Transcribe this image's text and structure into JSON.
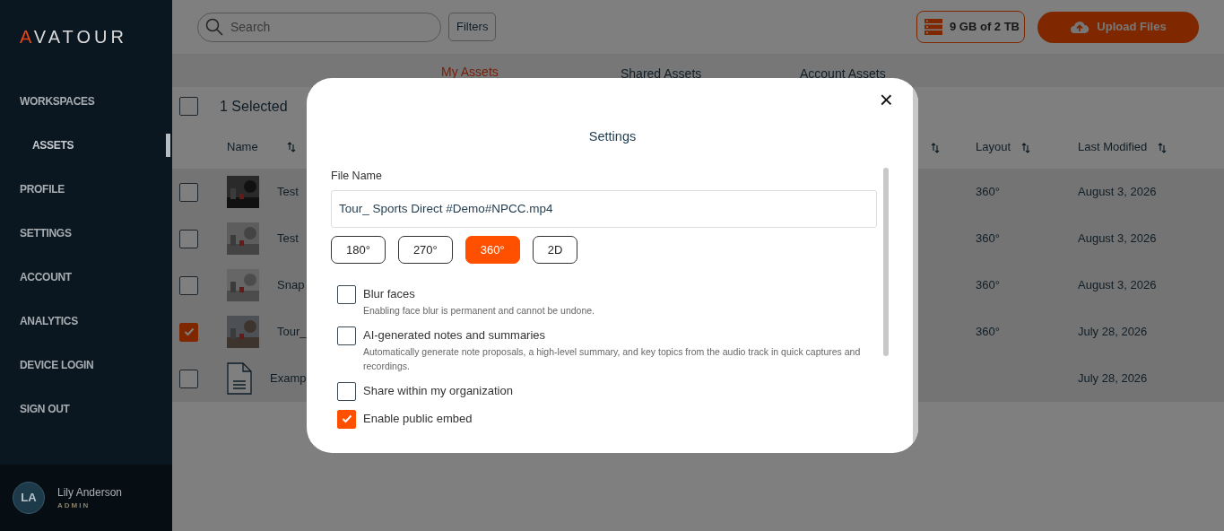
{
  "sidebar": {
    "logo": "AVATOUR",
    "items": [
      {
        "label": "WORKSPACES",
        "selected": false,
        "children": [
          {
            "label": "ASSETS",
            "selected": true
          }
        ]
      },
      {
        "label": "PROFILE",
        "selected": false
      },
      {
        "label": "SETTINGS",
        "selected": false
      },
      {
        "label": "ACCOUNT",
        "selected": false
      },
      {
        "label": "ANALYTICS",
        "selected": false
      },
      {
        "label": "DEVICE LOGIN",
        "selected": false
      },
      {
        "label": "SIGN OUT",
        "selected": false
      }
    ],
    "user": {
      "initials": "LA",
      "name": "Lily Anderson",
      "role": "ADMIN"
    }
  },
  "topbar": {
    "search": {
      "placeholder": "Search"
    },
    "filters": "Filters",
    "storage": "9 GB of 2 TB",
    "upload": "Upload Files"
  },
  "tabs": [
    {
      "label": "My Assets",
      "selected": true
    },
    {
      "label": "Shared Assets",
      "selected": false
    },
    {
      "label": "Account Assets",
      "selected": false
    }
  ],
  "toolbar": {
    "selected_count": "1 Selected",
    "select_all": false
  },
  "table": {
    "columns": [
      {
        "label": "Name"
      },
      {},
      {
        "label": "Layout"
      },
      {
        "label": "Last Modified"
      }
    ],
    "rows": [
      {
        "kind": "picture",
        "name": "Test",
        "layout": "360°",
        "modified": "August 3, 2026",
        "selected": false
      },
      {
        "kind": "picture",
        "name": "Test",
        "layout": "360°",
        "modified": "August 3, 2026",
        "selected": false
      },
      {
        "kind": "picture",
        "name": "Snap",
        "layout": "360°",
        "modified": "August 3, 2026",
        "selected": false
      },
      {
        "kind": "picture",
        "name": "Tour_",
        "layout": "360°",
        "modified": "July 28, 2026",
        "selected": true
      },
      {
        "kind": "document",
        "name": "Examp",
        "modified": "July 28, 2026",
        "selected": false
      }
    ]
  },
  "dialog": {
    "title": "Settings",
    "close": "×",
    "file_name_label": "File Name",
    "file_name": "Tour_ Sports Direct #Demo#NPCC.mp4",
    "layouts": [
      {
        "label": "180°",
        "selected": false
      },
      {
        "label": "270°",
        "selected": false
      },
      {
        "label": "360°",
        "selected": true
      },
      {
        "label": "2D",
        "selected": false
      }
    ],
    "options": [
      {
        "label": "Blur faces",
        "description": "Enabling face blur is permanent and cannot be undone.",
        "checked": false
      },
      {
        "label": "AI-generated notes and summaries",
        "description": "Automatically generate note proposals, a high-level summary, and key topics from the audio track in quick captures and recordings.",
        "checked": false
      },
      {
        "label": "Share within my organization",
        "checked": false
      },
      {
        "label": "Enable public embed",
        "checked": true
      }
    ]
  }
}
